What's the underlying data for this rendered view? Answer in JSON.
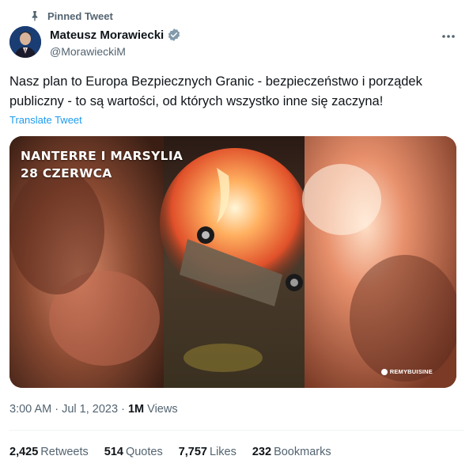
{
  "pinned_label": "Pinned Tweet",
  "author": {
    "name": "Mateusz Morawiecki",
    "handle": "@MorawieckiM",
    "verified": true
  },
  "tweet_text": "Nasz plan to Europa Bezpiecznych Granic - bezpieczeństwo i porządek publiczny - to są wartości, od których wszystko inne się zaczyna!",
  "translate_label": "Translate Tweet",
  "media": {
    "caption_line1": "NANTERRE I MARSYLIA",
    "caption_line2": "28 CZERWCA",
    "watermark": "REMYBUISINE"
  },
  "meta": {
    "time": "3:00 AM",
    "separator": "·",
    "date": "Jul 1, 2023",
    "views_count": "1M",
    "views_label": "Views"
  },
  "stats": [
    {
      "count": "2,425",
      "label": "Retweets"
    },
    {
      "count": "514",
      "label": "Quotes"
    },
    {
      "count": "7,757",
      "label": "Likes"
    },
    {
      "count": "232",
      "label": "Bookmarks"
    }
  ],
  "colors": {
    "link": "#1d9bf0",
    "secondary_text": "#536471",
    "primary_text": "#0f1419",
    "verified": "#829aab"
  }
}
